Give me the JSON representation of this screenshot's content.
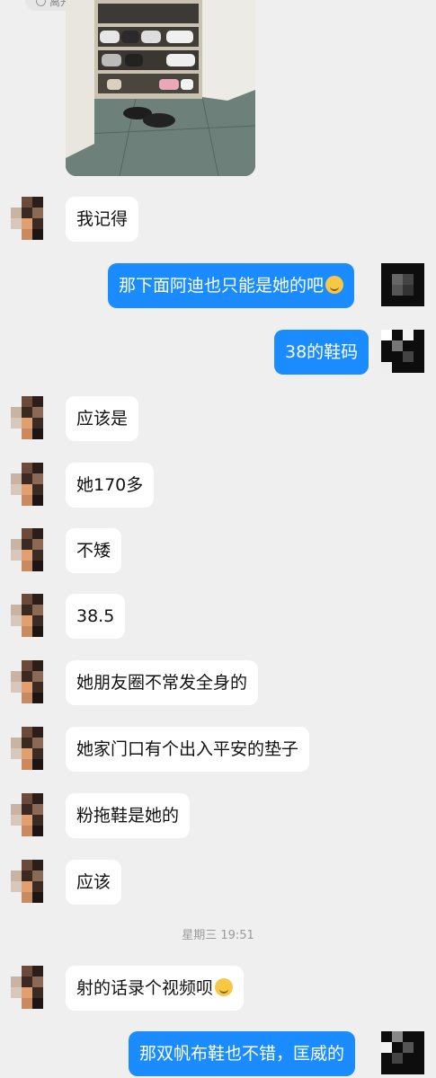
{
  "top_chip": {
    "label": "离开",
    "icon": "clock-icon"
  },
  "timestamp": "星期三 19:51",
  "colors": {
    "background": "#efefef",
    "incoming_bubble": "#ffffff",
    "outgoing_bubble": "#1a8cff"
  },
  "messages": [
    {
      "side": "in",
      "text": "我记得"
    },
    {
      "side": "out",
      "text": "那下面阿迪也只能是她的吧",
      "emoji": "thinking-face"
    },
    {
      "side": "out",
      "text": "38的鞋码"
    },
    {
      "side": "in",
      "text": "应该是"
    },
    {
      "side": "in",
      "text": "她170多"
    },
    {
      "side": "in",
      "text": "不矮"
    },
    {
      "side": "in",
      "text": "38.5"
    },
    {
      "side": "in",
      "text": "她朋友圈不常发全身的"
    },
    {
      "side": "in",
      "text": "她家门口有个出入平安的垫子"
    },
    {
      "side": "in",
      "text": "粉拖鞋是她的"
    },
    {
      "side": "in",
      "text": "应该"
    },
    {
      "side": "in",
      "text": "射的话录个视频呗",
      "emoji": "smiling-face"
    },
    {
      "side": "out",
      "text": "那双帆布鞋也不错，匡威的"
    }
  ]
}
